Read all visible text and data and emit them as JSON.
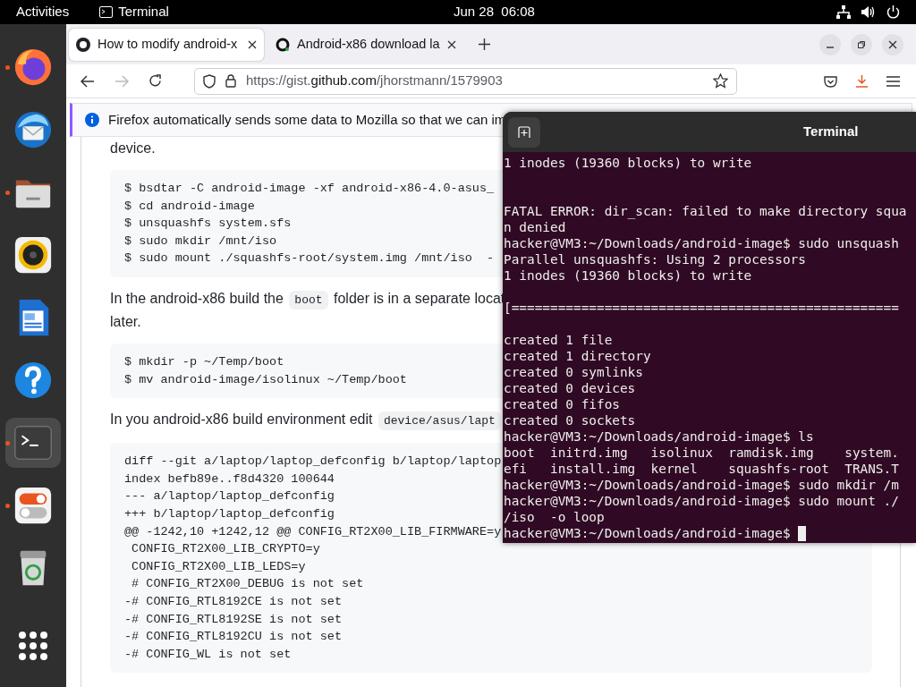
{
  "top_bar": {
    "activities": "Activities",
    "app": "Terminal",
    "clock": "Jun 28  06:08"
  },
  "dock": [
    {
      "kind": "firefox",
      "running": true,
      "selected": false
    },
    {
      "kind": "mail",
      "running": false,
      "selected": false
    },
    {
      "kind": "files",
      "running": true,
      "selected": false
    },
    {
      "kind": "music",
      "running": false,
      "selected": false
    },
    {
      "kind": "writer",
      "running": false,
      "selected": false
    },
    {
      "kind": "help",
      "running": false,
      "selected": false
    },
    {
      "kind": "terminal",
      "running": true,
      "selected": true
    },
    {
      "kind": "software",
      "running": true,
      "selected": false
    },
    {
      "kind": "trash",
      "running": false,
      "selected": false
    },
    {
      "kind": "apps",
      "running": false,
      "selected": false
    }
  ],
  "browser": {
    "tabs": [
      {
        "title": "How to modify android-x",
        "selected": true
      },
      {
        "title": "Android-x86 download la",
        "selected": false
      }
    ],
    "forward_disabled": true,
    "url": {
      "before": "https://gist.",
      "domain": "github.com",
      "after": "/jhorstmann/1579903"
    },
    "notification": "Firefox automatically sends some data to Mozilla so that we can im",
    "page": [
      {
        "kind": "text",
        "lines": [
          [
            {
              "kind": "text",
              "text": "device."
            }
          ]
        ]
      },
      {
        "kind": "code",
        "lines": [
          "$ bsdtar -C android-image -xf android-x86-4.0-asus_",
          "$ cd android-image",
          "$ unsquashfs system.sfs",
          "$ sudo mkdir /mnt/iso",
          "$ sudo mount ./squashfs-root/system.img /mnt/iso  -"
        ]
      },
      {
        "kind": "text",
        "lines": [
          [
            {
              "kind": "text",
              "text": "In the android-x86 build the "
            },
            {
              "kind": "code",
              "text": "boot"
            },
            {
              "kind": "text",
              "text": " folder is in a separate locat"
            }
          ],
          [
            {
              "kind": "text",
              "text": "later."
            }
          ]
        ]
      },
      {
        "kind": "code",
        "lines": [
          "$ mkdir -p ~/Temp/boot",
          "$ mv android-image/isolinux ~/Temp/boot"
        ]
      },
      {
        "kind": "text",
        "lines": [
          [
            {
              "kind": "text",
              "text": "In you android-x86 build environment edit "
            },
            {
              "kind": "code",
              "text": "device/asus/lapt"
            }
          ]
        ]
      },
      {
        "kind": "code",
        "lines": [
          "diff --git a/laptop/laptop_defconfig b/laptop/laptop",
          "index befb89e..f8d4320 100644",
          "--- a/laptop/laptop_defconfig",
          "+++ b/laptop/laptop_defconfig",
          "@@ -1242,10 +1242,12 @@ CONFIG_RT2X00_LIB_FIRMWARE=y",
          " CONFIG_RT2X00_LIB_CRYPTO=y",
          " CONFIG_RT2X00_LIB_LEDS=y",
          " # CONFIG_RT2X00_DEBUG is not set",
          "-# CONFIG_RTL8192CE is not set",
          "-# CONFIG_RTL8192SE is not set",
          "-# CONFIG_RTL8192CU is not set",
          "-# CONFIG_WL is not set"
        ]
      }
    ]
  },
  "terminal": {
    "title": "Terminal",
    "cursor": true,
    "lines": [
      {
        "kind": "text",
        "text": "1 inodes (19360 blocks) to write"
      },
      {
        "kind": "blank"
      },
      {
        "kind": "blank"
      },
      {
        "kind": "text",
        "text": "FATAL ERROR: dir_scan: failed to make directory squa"
      },
      {
        "kind": "text",
        "text": "n denied"
      },
      {
        "kind": "text",
        "text": "hacker@VM3:~/Downloads/android-image$ sudo unsquash"
      },
      {
        "kind": "text",
        "text": "Parallel unsquashfs: Using 2 processors"
      },
      {
        "kind": "text",
        "text": "1 inodes (19360 blocks) to write"
      },
      {
        "kind": "blank"
      },
      {
        "kind": "text",
        "text": "[=================================================="
      },
      {
        "kind": "blank"
      },
      {
        "kind": "text",
        "text": "created 1 file"
      },
      {
        "kind": "text",
        "text": "created 1 directory"
      },
      {
        "kind": "text",
        "text": "created 0 symlinks"
      },
      {
        "kind": "text",
        "text": "created 0 devices"
      },
      {
        "kind": "text",
        "text": "created 0 fifos"
      },
      {
        "kind": "text",
        "text": "created 0 sockets"
      },
      {
        "kind": "text",
        "text": "hacker@VM3:~/Downloads/android-image$ ls"
      },
      {
        "kind": "text",
        "text": "boot  initrd.img   isolinux  ramdisk.img    system."
      },
      {
        "kind": "text",
        "text": "efi   install.img  kernel    squashfs-root  TRANS.T"
      },
      {
        "kind": "text",
        "text": "hacker@VM3:~/Downloads/android-image$ sudo mkdir /m"
      },
      {
        "kind": "text",
        "text": "hacker@VM3:~/Downloads/android-image$ sudo mount ./"
      },
      {
        "kind": "text",
        "text": "/iso  -o loop"
      },
      {
        "kind": "text",
        "text": "hacker@VM3:~/Downloads/android-image$ "
      }
    ]
  }
}
